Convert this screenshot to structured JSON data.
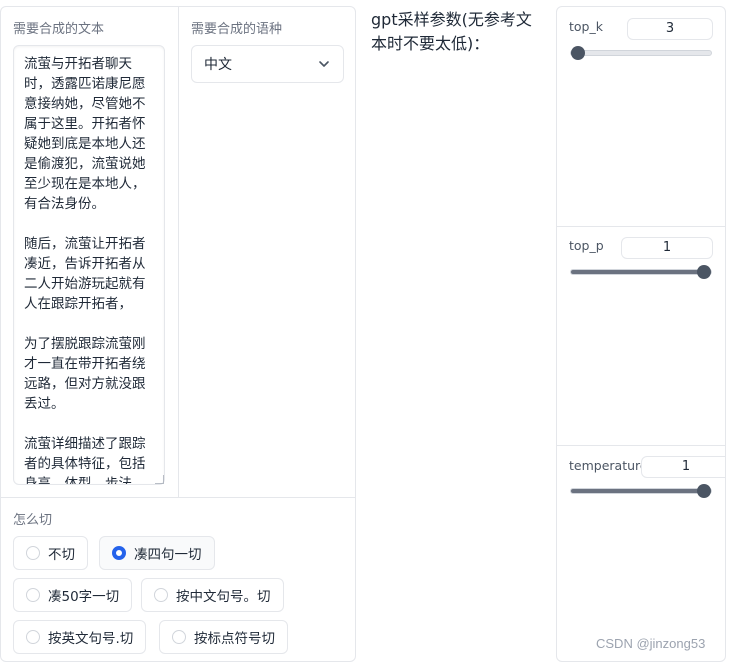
{
  "text_panel": {
    "label": "需要合成的文本",
    "value": "流萤与开拓者聊天时，透露匹诺康尼愿意接纳她，尽管她不属于这里。开拓者怀疑她到底是本地人还是偷渡犯，流萤说她至少现在是本地人，有合法身份。\n\n随后，流萤让开拓者凑近，告诉开拓者从二人开始游玩起就有人在跟踪开拓者，\n\n为了摆脱跟踪流萤刚才一直在带开拓者绕远路，但对方就没跟丢过。\n\n流萤详细描述了跟踪者的具体特征，包括身高、体型、步法"
  },
  "language_panel": {
    "label": "需要合成的语种",
    "selected": "中文"
  },
  "split_panel": {
    "label": "怎么切",
    "options": [
      {
        "label": "不切",
        "selected": false
      },
      {
        "label": "凑四句一切",
        "selected": true
      },
      {
        "label": "凑50字一切",
        "selected": false
      },
      {
        "label": "按中文句号。切",
        "selected": false
      },
      {
        "label": "按英文句号.切",
        "selected": false
      },
      {
        "label": "按标点符号切",
        "selected": false
      }
    ]
  },
  "gpt_params": {
    "label": "gpt采样参数(无参考文本时不要太低)："
  },
  "sliders": {
    "top_k": {
      "label": "top_k",
      "value": "3",
      "fraction": 0.0
    },
    "top_p": {
      "label": "top_p",
      "value": "1",
      "fraction": 1.0
    },
    "temperature": {
      "label": "temperature",
      "value": "1",
      "fraction": 1.0
    }
  },
  "watermark": "CSDN @jinzong53"
}
